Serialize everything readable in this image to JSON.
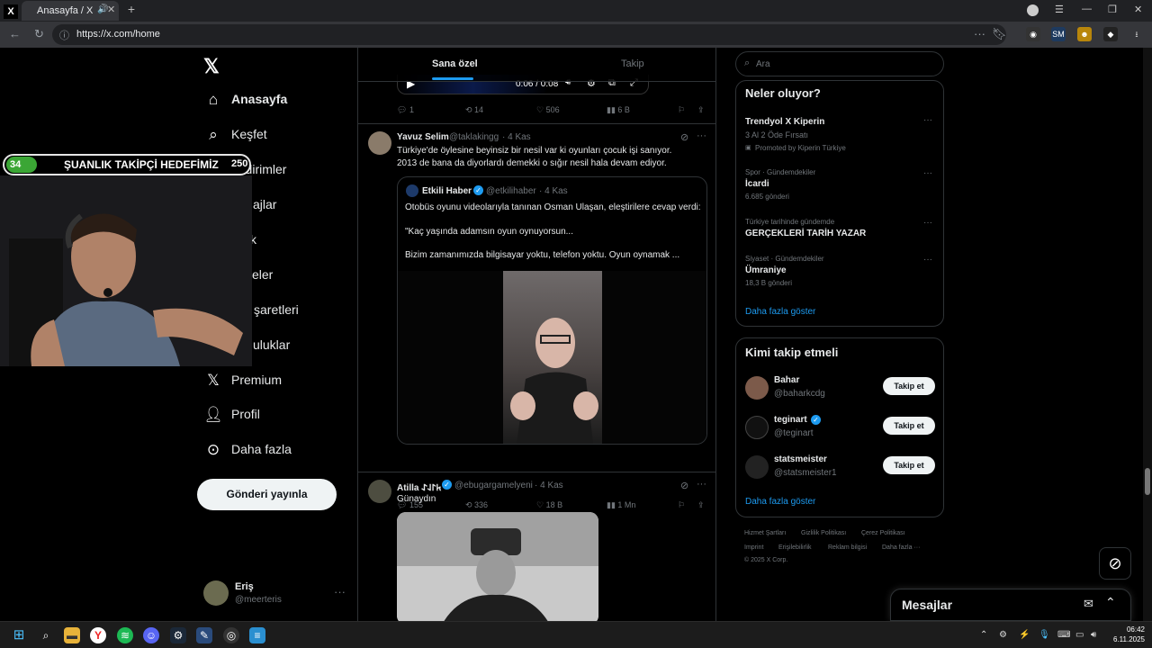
{
  "browser": {
    "tab_title": "Anasayfa / X",
    "url": "https://x.com/home"
  },
  "overlay": {
    "current_followers": "34",
    "goal_text": "ŞUANLIK TAKİPÇİ HEDEFİMİZ",
    "goal_value": "250"
  },
  "leftnav": {
    "items": [
      {
        "label": "Anasayfa"
      },
      {
        "label": "Keşfet"
      },
      {
        "label": "Bildirimler"
      },
      {
        "label": "ajlar"
      },
      {
        "label": "k"
      },
      {
        "label": "eler"
      },
      {
        "label": "şaretleri"
      },
      {
        "label": "uluklar"
      },
      {
        "label": "Premium"
      },
      {
        "label": "Profil"
      },
      {
        "label": "Daha fazla"
      }
    ],
    "post_button": "Gönderi yayınla",
    "account": {
      "name": "Eriş",
      "handle": "@meerteris"
    }
  },
  "feed": {
    "tabs": [
      "Sana özel",
      "Takip"
    ],
    "player_time": "0:06 / 0:08",
    "tweet0_actions": {
      "replies": "1",
      "reposts": "14",
      "likes": "506",
      "views": "6 B"
    },
    "tweet1": {
      "name": "Yavuz Selim",
      "handle": "@taklakingg",
      "time": "· 4 Kas",
      "text_line1": "Türkiye'de öylesine beyinsiz bir nesil var ki oyunları çocuk işi sanıyor.",
      "text_line2": "2013 de bana da diyorlardı demekki o sığır nesil hala devam ediyor.",
      "quote": {
        "name": "Etkili Haber",
        "handle": "@etkilihaber",
        "time": "· 4 Kas",
        "line1": "Otobüs oyunu videolarıyla tanınan Osman Ulaşan, eleştirilere cevap verdi:",
        "line2": "\"Kaç yaşında adamsın oyun oynuyorsun...",
        "line3": "Bizim zamanımızda bilgisayar yoktu, telefon yoktu. Oyun oynamak ..."
      },
      "actions": {
        "replies": "155",
        "reposts": "336",
        "likes": "18 B",
        "views": "1 Mn"
      }
    },
    "tweet2": {
      "name": "Atilla 𐱅𐰃𐰞𐰀",
      "handle": "@ebugargamelyeni",
      "time": "· 4 Kas",
      "text": "Günaydın"
    }
  },
  "right": {
    "search_placeholder": "Ara",
    "trends_title": "Neler oluyor?",
    "trends": [
      {
        "top": "",
        "title": "Trendyol X Kiperin",
        "sub": "3 Al 2 Öde Fırsatı",
        "extra": "Promoted by Kiperin Türkiye"
      },
      {
        "top": "Spor · Gündemdekiler",
        "title": "İcardi",
        "sub": "6.685 gönderi"
      },
      {
        "top": "Türkiye tarihinde gündemde",
        "title": "GERÇEKLERİ TARİH YAZAR",
        "sub": ""
      },
      {
        "top": "Siyaset · Gündemdekiler",
        "title": "Ümraniye",
        "sub": "18,3 B gönderi"
      }
    ],
    "show_more": "Daha fazla göster",
    "follow_title": "Kimi takip etmeli",
    "follow": [
      {
        "name": "Bahar",
        "handle": "@baharkcdg"
      },
      {
        "name": "teginart",
        "handle": "@teginart"
      },
      {
        "name": "statsmeister",
        "handle": "@statsmeister1"
      }
    ],
    "follow_button": "Takip et",
    "footer": [
      "Hizmet Şartları",
      "Gizlilik Politikası",
      "Çerez Politikası",
      "Imprint",
      "Erişilebilirlik",
      "Reklam bilgisi",
      "Daha fazla ···",
      "© 2025 X Corp."
    ],
    "messages": "Mesajlar"
  },
  "taskbar": {
    "time": "06:42",
    "date": "6.11.2025"
  },
  "colors": {
    "accent": "#1d9bf0",
    "overlay_green": "#3ba635",
    "background": "#000000"
  }
}
